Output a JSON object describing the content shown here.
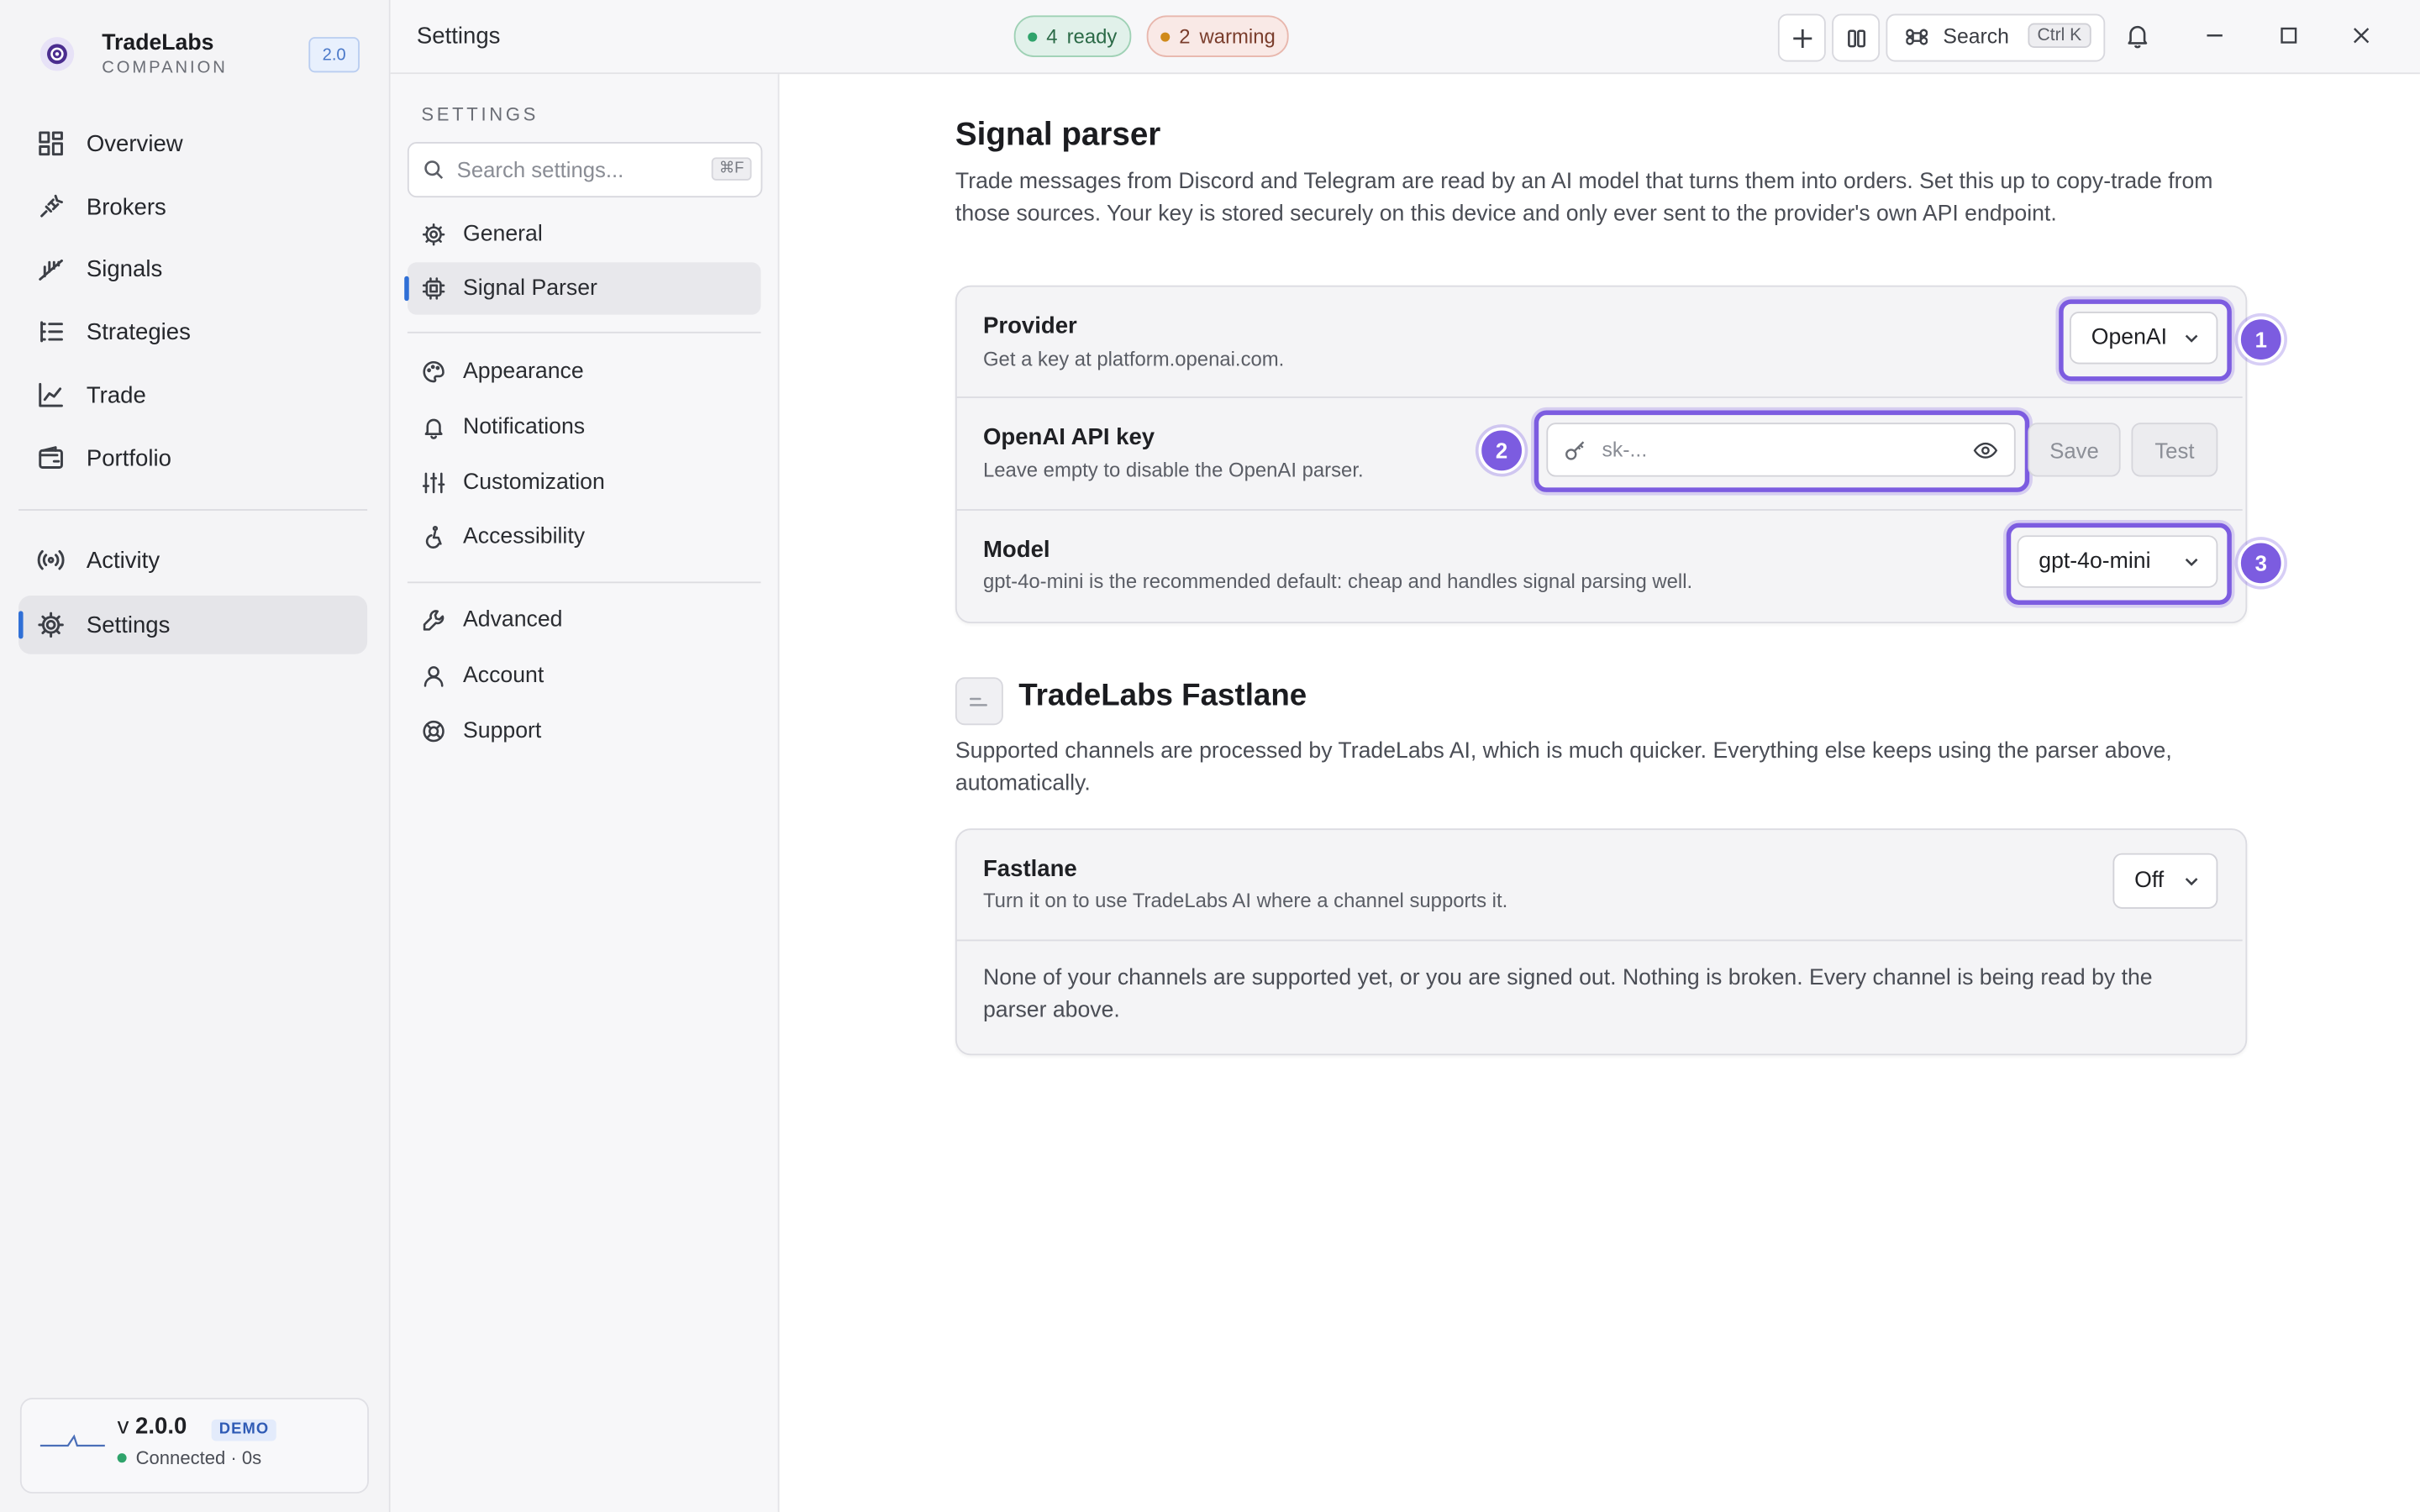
{
  "app": {
    "name": "TradeLabs",
    "subtitle": "COMPANION",
    "version_badge": "2.0"
  },
  "sidebar": {
    "items": [
      {
        "label": "Overview",
        "icon": "grid-icon"
      },
      {
        "label": "Brokers",
        "icon": "plug-icon"
      },
      {
        "label": "Signals",
        "icon": "signal-icon"
      },
      {
        "label": "Strategies",
        "icon": "list-tree-icon"
      },
      {
        "label": "Trade",
        "icon": "line-chart-icon"
      },
      {
        "label": "Portfolio",
        "icon": "wallet-icon"
      },
      {
        "label": "Activity",
        "icon": "broadcast-icon"
      },
      {
        "label": "Settings",
        "icon": "gear-icon",
        "active": true
      }
    ],
    "footer": {
      "version_prefix": "v",
      "version": "2.0.0",
      "tag": "DEMO",
      "connection": "Connected · 0s",
      "connection_color": "#2fa36b"
    }
  },
  "titlebar": {
    "title": "Settings",
    "ready_count": "4",
    "ready_label": "ready",
    "warming_count": "2",
    "warming_label": "warming",
    "search_label": "Search",
    "search_shortcut": "Ctrl K"
  },
  "settings_nav": {
    "heading": "SETTINGS",
    "search_placeholder": "Search settings...",
    "search_shortcut": "⌘F",
    "items": [
      {
        "label": "General"
      },
      {
        "label": "Signal Parser",
        "active": true
      },
      {
        "label": "Appearance"
      },
      {
        "label": "Notifications"
      },
      {
        "label": "Customization"
      },
      {
        "label": "Accessibility"
      },
      {
        "label": "Advanced"
      },
      {
        "label": "Account"
      },
      {
        "label": "Support"
      }
    ]
  },
  "signal_parser": {
    "title": "Signal parser",
    "description": "Trade messages from Discord and Telegram are read by an AI model that turns them into orders. Set this up to copy-trade from those sources. Your key is stored securely on this device and only ever sent to the provider's own API endpoint.",
    "provider": {
      "title": "Provider",
      "desc": "Get a key at platform.openai.com.",
      "value": "OpenAI",
      "badge": "1"
    },
    "api_key": {
      "title": "OpenAI API key",
      "desc": "Leave empty to disable the OpenAI parser.",
      "placeholder": "sk-...",
      "save_label": "Save",
      "test_label": "Test",
      "badge": "2"
    },
    "model": {
      "title": "Model",
      "desc": "gpt-4o-mini is the recommended default: cheap and handles signal parsing well.",
      "value": "gpt-4o-mini",
      "badge": "3"
    }
  },
  "fastlane": {
    "title": "TradeLabs Fastlane",
    "description": "Supported channels are processed by TradeLabs AI, which is much quicker. Everything else keeps using the parser above, automatically.",
    "row": {
      "title": "Fastlane",
      "desc": "Turn it on to use TradeLabs AI where a channel supports it.",
      "value": "Off"
    },
    "notice": "None of your channels are supported yet, or you are signed out. Nothing is broken. Every channel is being read by the parser above."
  },
  "colors": {
    "accent": "#7c5ce0",
    "active_indicator": "#2f6fd6",
    "ready_dot": "#2fa36b",
    "warming_dot": "#d08a1a"
  }
}
